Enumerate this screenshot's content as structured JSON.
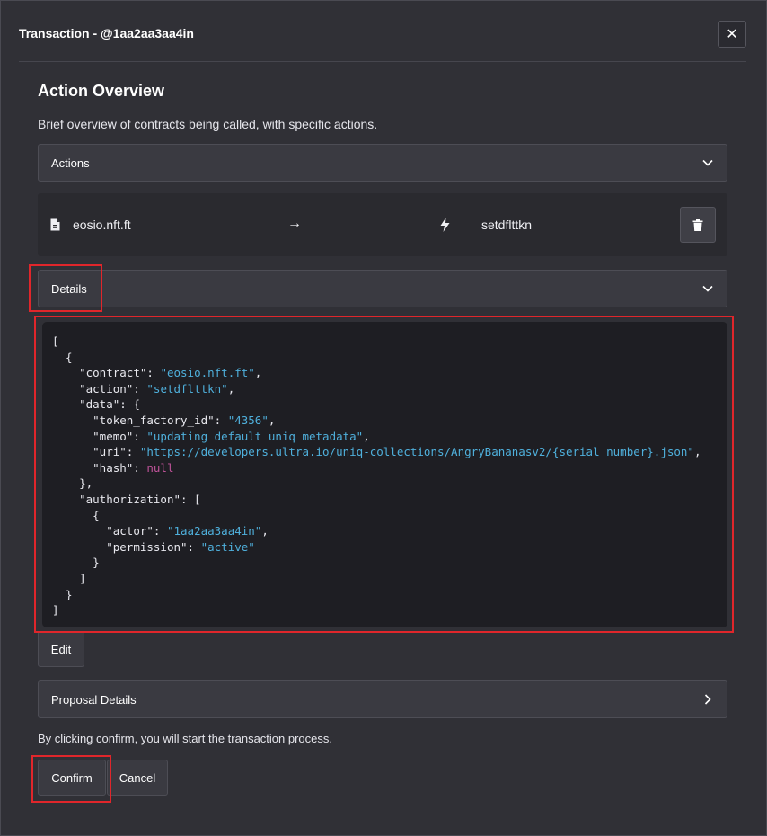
{
  "modal": {
    "title": "Transaction - @1aa2aa3aa4in",
    "close_label": "✕"
  },
  "overview": {
    "heading": "Action Overview",
    "description": "Brief overview of contracts being called, with specific actions."
  },
  "actions_accordion": {
    "label": "Actions"
  },
  "action": {
    "contract": "eosio.nft.ft",
    "arrow": "→",
    "name": "setdflttkn"
  },
  "details_accordion": {
    "label": "Details"
  },
  "details_json": [
    "[",
    "  {",
    "    \"contract\": \"eosio.nft.ft\",",
    "    \"action\": \"setdflttkn\",",
    "    \"data\": {",
    "      \"token_factory_id\": \"4356\",",
    "      \"memo\": \"updating default uniq metadata\",",
    "      \"uri\": \"https://developers.ultra.io/uniq-collections/AngryBananasv2/{serial_number}.json\",",
    "      \"hash\": null",
    "    },",
    "    \"authorization\": [",
    "      {",
    "        \"actor\": \"1aa2aa3aa4in\",",
    "        \"permission\": \"active\"",
    "      }",
    "    ]",
    "  }",
    "]"
  ],
  "buttons": {
    "edit": "Edit",
    "confirm": "Confirm",
    "cancel": "Cancel"
  },
  "proposal_accordion": {
    "label": "Proposal Details"
  },
  "confirm_note": "By clicking confirm, you will start the transaction process.",
  "colors": {
    "string": "#4fb0dc",
    "null": "#c0539a",
    "highlight": "#e0262b"
  }
}
